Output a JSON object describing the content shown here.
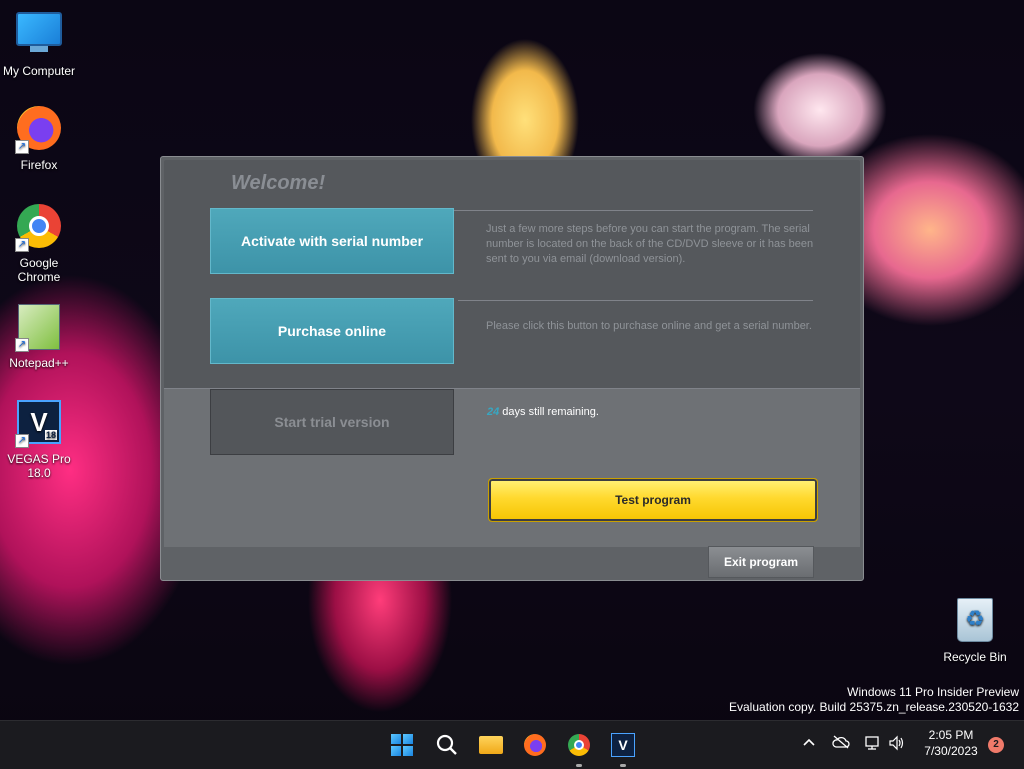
{
  "desktop": {
    "icons": [
      {
        "label": "My Computer",
        "icon": "monitor-icon"
      },
      {
        "label": "Firefox",
        "icon": "firefox-icon"
      },
      {
        "label": "Google Chrome",
        "icon": "chrome-icon"
      },
      {
        "label": "Notepad++",
        "icon": "notepadpp-icon"
      },
      {
        "label": "VEGAS Pro 18.0",
        "icon": "vegas-icon"
      },
      {
        "label": "Recycle Bin",
        "icon": "recycle-bin-icon"
      }
    ],
    "shortcut_glyph": "↗",
    "vegas_badge": "18",
    "vegas_letter": "V",
    "watermark": {
      "line1": "Windows 11 Pro Insider Preview",
      "line2": "Evaluation copy. Build 25375.zn_release.230520-1632"
    }
  },
  "dialog": {
    "title": "Welcome!",
    "activate_label": "Activate with serial number",
    "activate_desc": "Just a few more steps before you can start the program. The serial number is located on the back of the CD/DVD sleeve or it has been sent to you via email (download version).",
    "purchase_label": "Purchase online",
    "purchase_desc": "Please click this button to purchase online and get a serial number.",
    "trial_label": "Start trial version",
    "trial_days": "24",
    "trial_suffix": " days still remaining.",
    "test_label": "Test program",
    "exit_label": "Exit program"
  },
  "taskbar": {
    "clock_time": "2:05 PM",
    "clock_date": "7/30/2023",
    "notification_count": "2",
    "apps": [
      "start-icon",
      "search-icon",
      "file-explorer-icon",
      "firefox-icon",
      "chrome-icon",
      "vegas-icon"
    ],
    "tray": [
      "chevron-up-icon",
      "cloud-off-icon",
      "network-icon",
      "volume-icon"
    ]
  },
  "colors": {
    "accent_blue": "#3d93a8",
    "test_yellow": "#ffd92e",
    "trial_days_color": "#37a7c2"
  }
}
